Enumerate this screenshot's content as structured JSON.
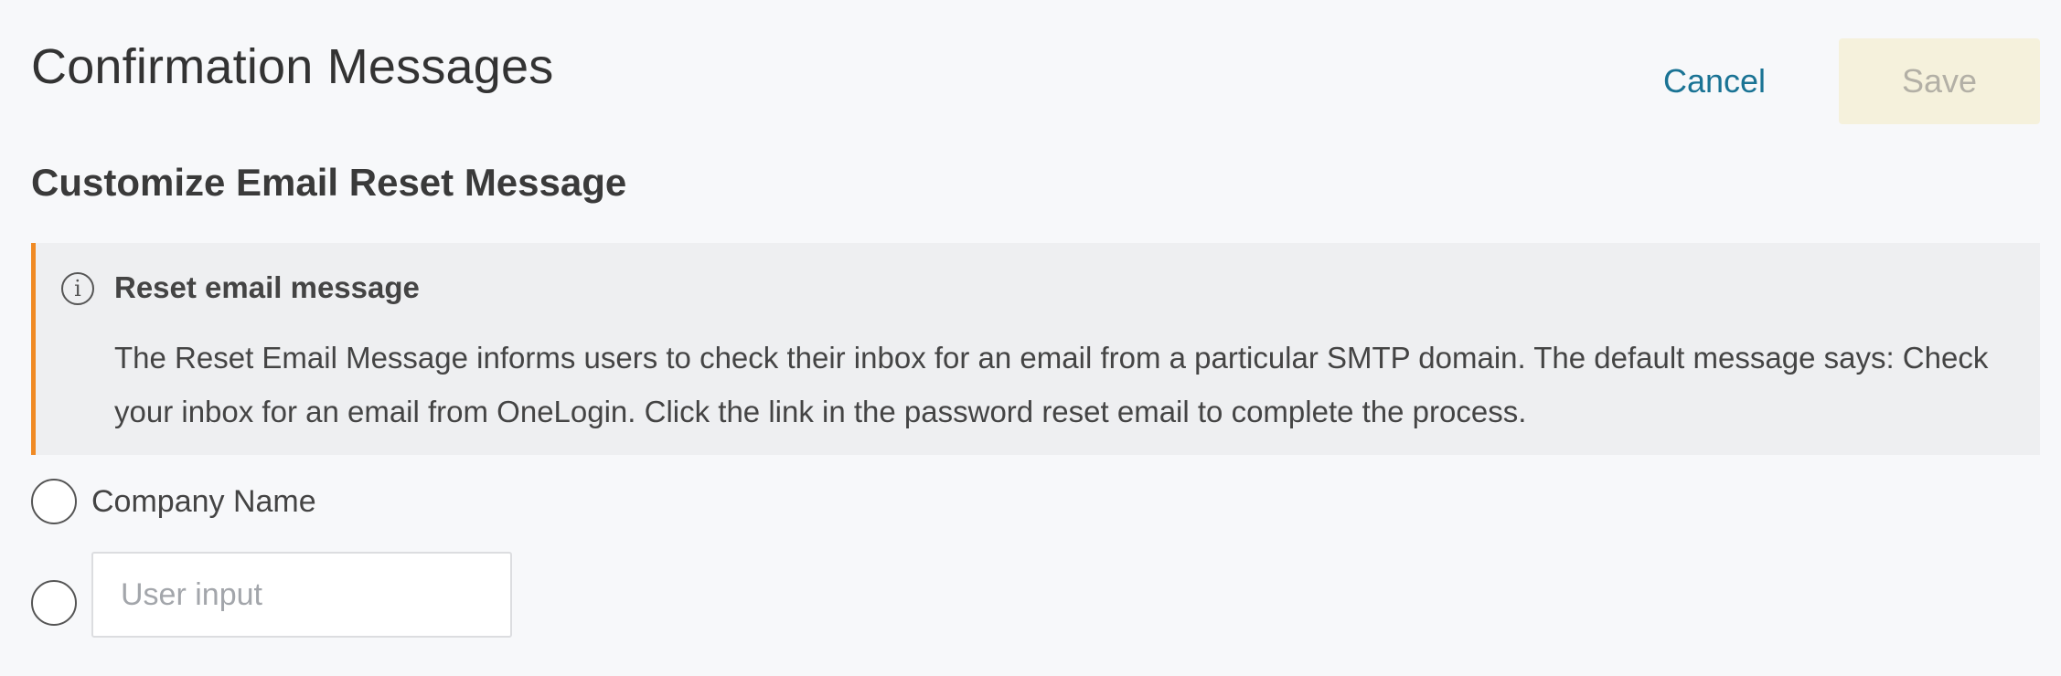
{
  "header": {
    "title": "Confirmation Messages",
    "cancel_label": "Cancel",
    "save_label": "Save"
  },
  "section": {
    "title": "Customize Email Reset Message"
  },
  "info": {
    "icon": "info-icon",
    "title": "Reset email message",
    "body": "The Reset Email Message informs users to check their inbox for an email from a particular SMTP domain. The default message says: Check your inbox for an email from OneLogin. Click the link in the password reset email to complete the process.",
    "accent_color": "#f08a24"
  },
  "options": {
    "company_name_label": "Company Name",
    "user_input_value": "",
    "user_input_placeholder": "User input"
  },
  "colors": {
    "link": "#1a7394",
    "save_disabled_bg": "#f5f1dc",
    "background": "#f7f8fa"
  }
}
